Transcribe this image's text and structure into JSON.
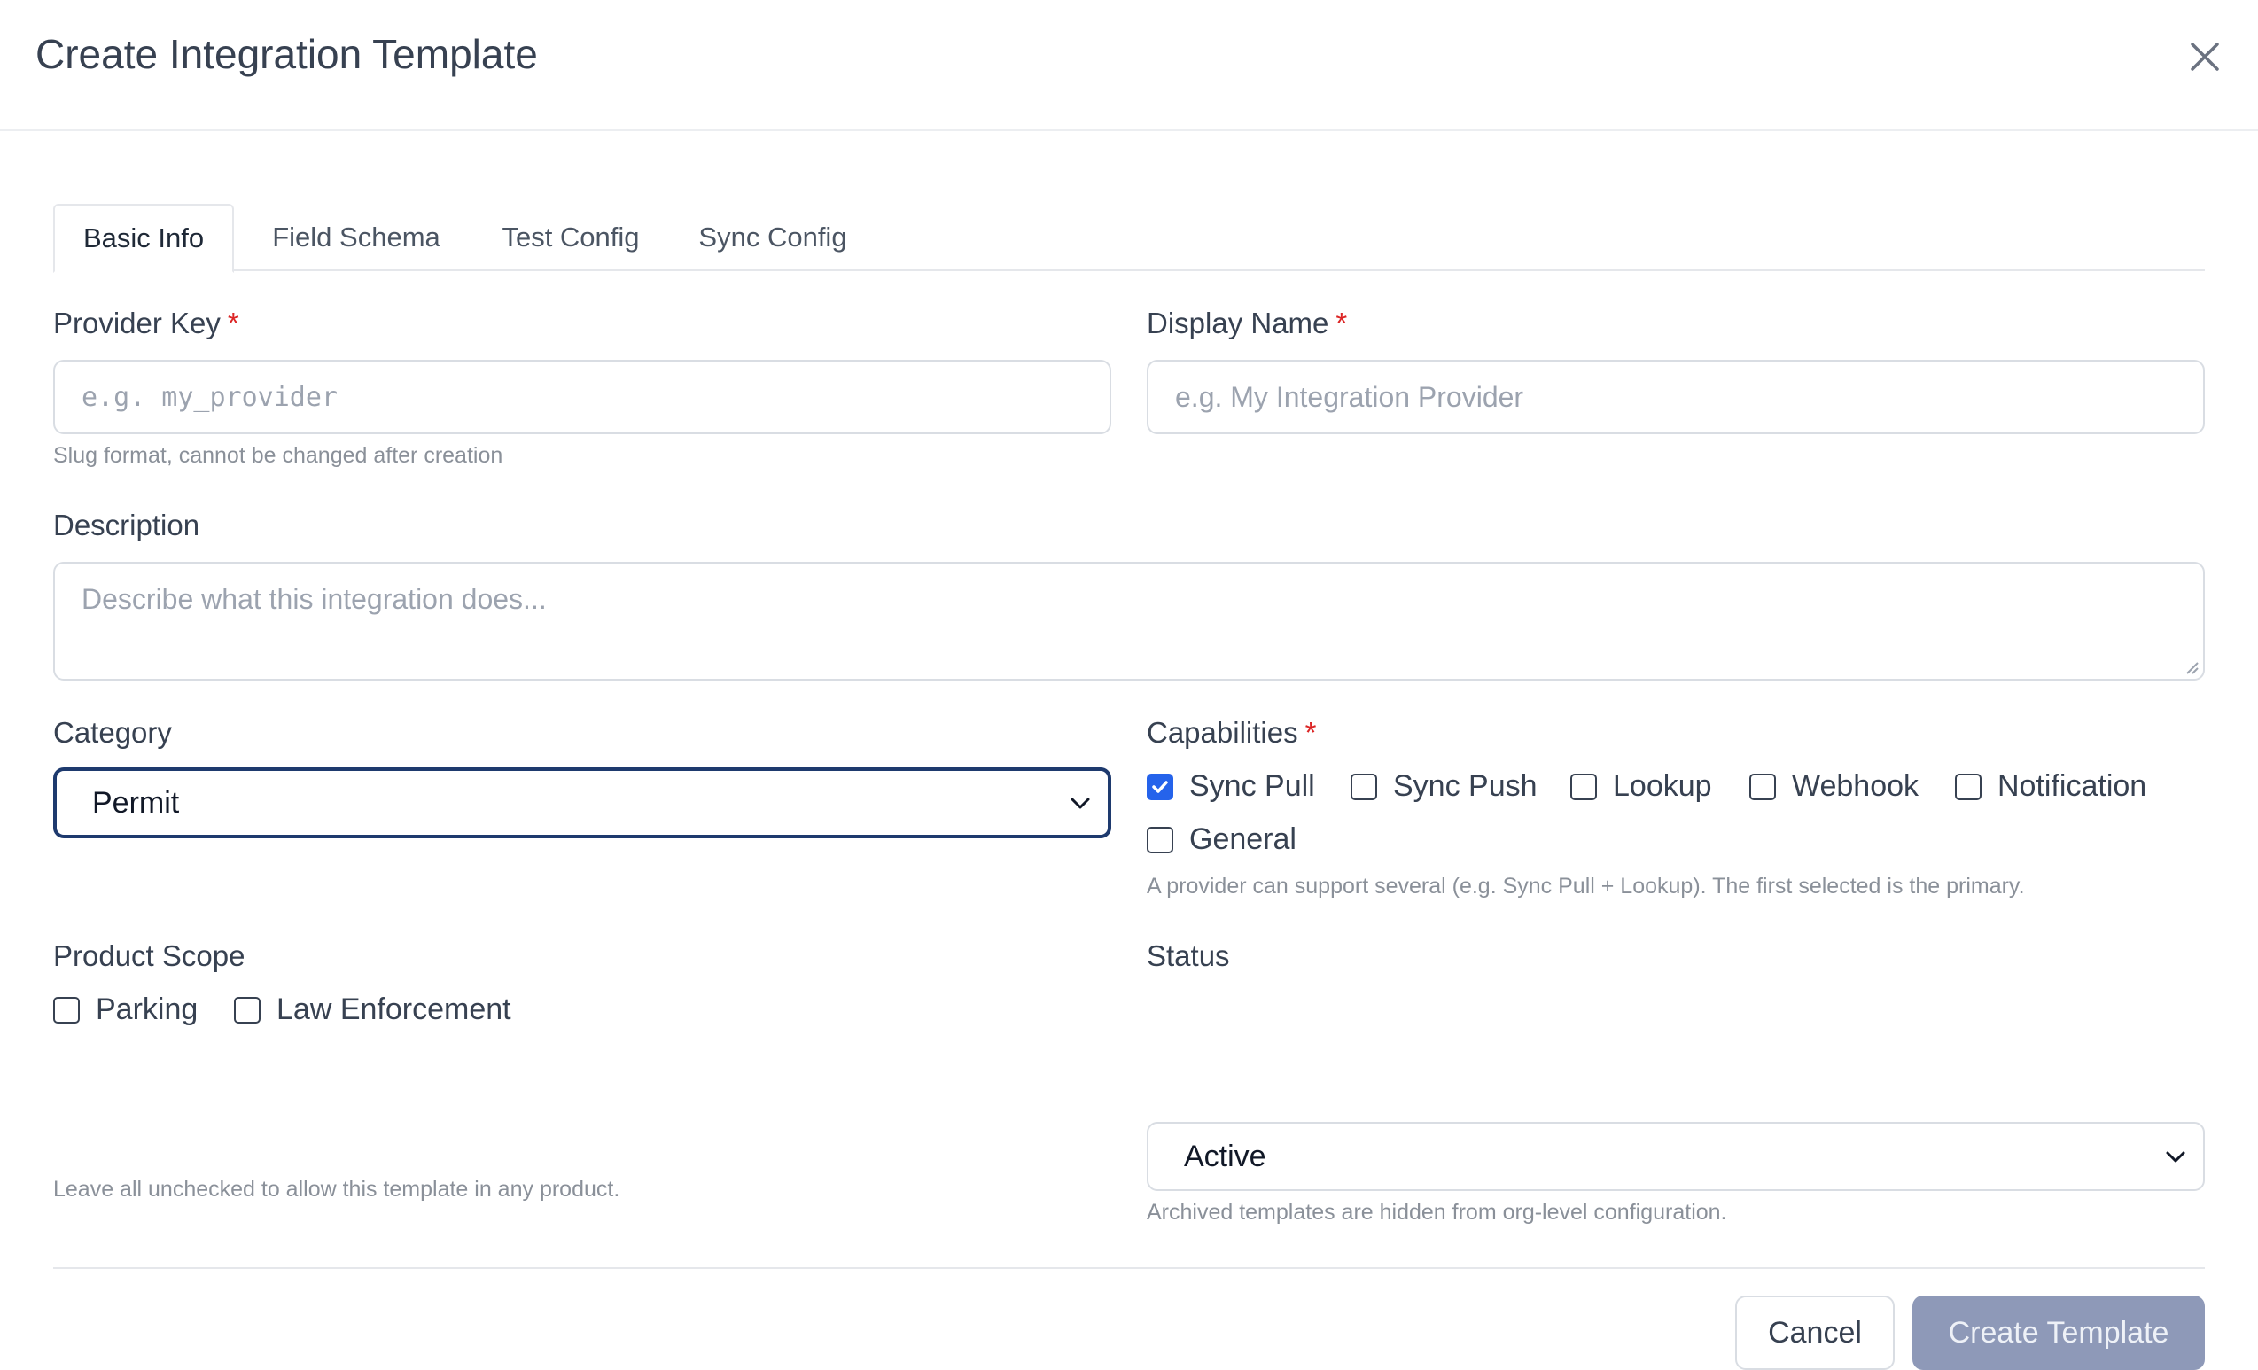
{
  "dialog": {
    "title": "Create Integration Template"
  },
  "tabs": [
    {
      "label": "Basic Info",
      "active": true
    },
    {
      "label": "Field Schema",
      "active": false
    },
    {
      "label": "Test Config",
      "active": false
    },
    {
      "label": "Sync Config",
      "active": false
    }
  ],
  "provider_key": {
    "label": "Provider Key",
    "required_mark": "*",
    "placeholder": "e.g. my_provider",
    "value": "",
    "helper": "Slug format, cannot be changed after creation"
  },
  "display_name": {
    "label": "Display Name",
    "required_mark": "*",
    "placeholder": "e.g. My Integration Provider",
    "value": ""
  },
  "description": {
    "label": "Description",
    "placeholder": "Describe what this integration does...",
    "value": ""
  },
  "category": {
    "label": "Category",
    "selected": "Permit"
  },
  "capabilities": {
    "label": "Capabilities",
    "required_mark": "*",
    "options": [
      {
        "label": "Sync Pull",
        "checked": true
      },
      {
        "label": "Sync Push",
        "checked": false
      },
      {
        "label": "Lookup",
        "checked": false
      },
      {
        "label": "Webhook",
        "checked": false
      },
      {
        "label": "Notification",
        "checked": false
      },
      {
        "label": "General",
        "checked": false
      }
    ],
    "helper": "A provider can support several (e.g. Sync Pull + Lookup). The first selected is the primary."
  },
  "product_scope": {
    "label": "Product Scope",
    "options": [
      {
        "label": "Parking",
        "checked": false
      },
      {
        "label": "Law Enforcement",
        "checked": false
      }
    ],
    "helper": "Leave all unchecked to allow this template in any product."
  },
  "status": {
    "label": "Status",
    "selected": "Active",
    "helper": "Archived templates are hidden from org-level configuration."
  },
  "footer": {
    "cancel_label": "Cancel",
    "submit_label": "Create Template"
  },
  "colors": {
    "accent": "#2563eb",
    "focus_border": "#1e3a6e",
    "required": "#dc2626",
    "primary_disabled": "#8e99b8"
  },
  "icons": {
    "close": "close-icon",
    "select_chevron": "chevron-down-icon",
    "checkbox_checked": "check-icon",
    "textarea_resize": "resize-handle-icon"
  }
}
